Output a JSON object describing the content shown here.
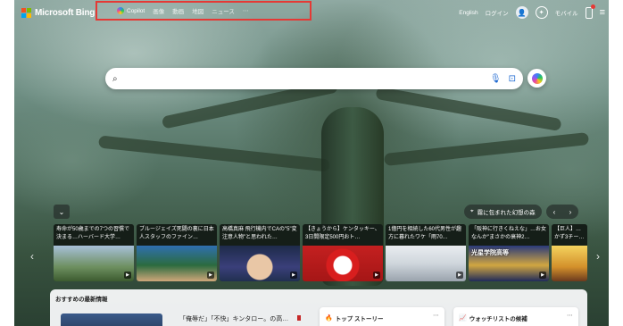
{
  "header": {
    "logo_text": "Microsoft Bing",
    "nav": {
      "copilot_label": "Copilot",
      "items": [
        "画像",
        "動画",
        "地図",
        "ニュース",
        "⋯"
      ]
    },
    "language": "English",
    "login": "ログイン",
    "mobile": "モバイル"
  },
  "search": {
    "placeholder": ""
  },
  "image": {
    "caption": "霧に包まれた幻想の森"
  },
  "cards": [
    {
      "title": "寿命が50歳までの7つの習慣で決まる…ハーバード大学…"
    },
    {
      "title": "ブルージェイズ死闘の裏に日本人スタッフのファイン…"
    },
    {
      "title": "高橋真麻 飛行機内でCAの\"5\"変注意人物\"と思われた…"
    },
    {
      "title": "【きょうから】ケンタッキー、3日間限定500円おト…"
    },
    {
      "title": "1億円を相続した60代男性が趣方に暮れたワケ「雨70…"
    },
    {
      "title": "「阪神に行きくねえな」…お女なんか\"まさかの衰神2…"
    },
    {
      "title": "【巨人】…かず3チー…",
      "overlay": "光星学院高等"
    }
  ],
  "feed": {
    "section_title": "おすすめの最新情報",
    "headline": "「俺辱だ」「不快」キンタロー。の高…",
    "top_stories": "トップ ストーリー",
    "watchlist": "ウォッチリストの候補"
  },
  "colors": {
    "highlight_border": "#e53935",
    "search_bg": "#ffffff",
    "accent_blue": "#1a66d0"
  }
}
